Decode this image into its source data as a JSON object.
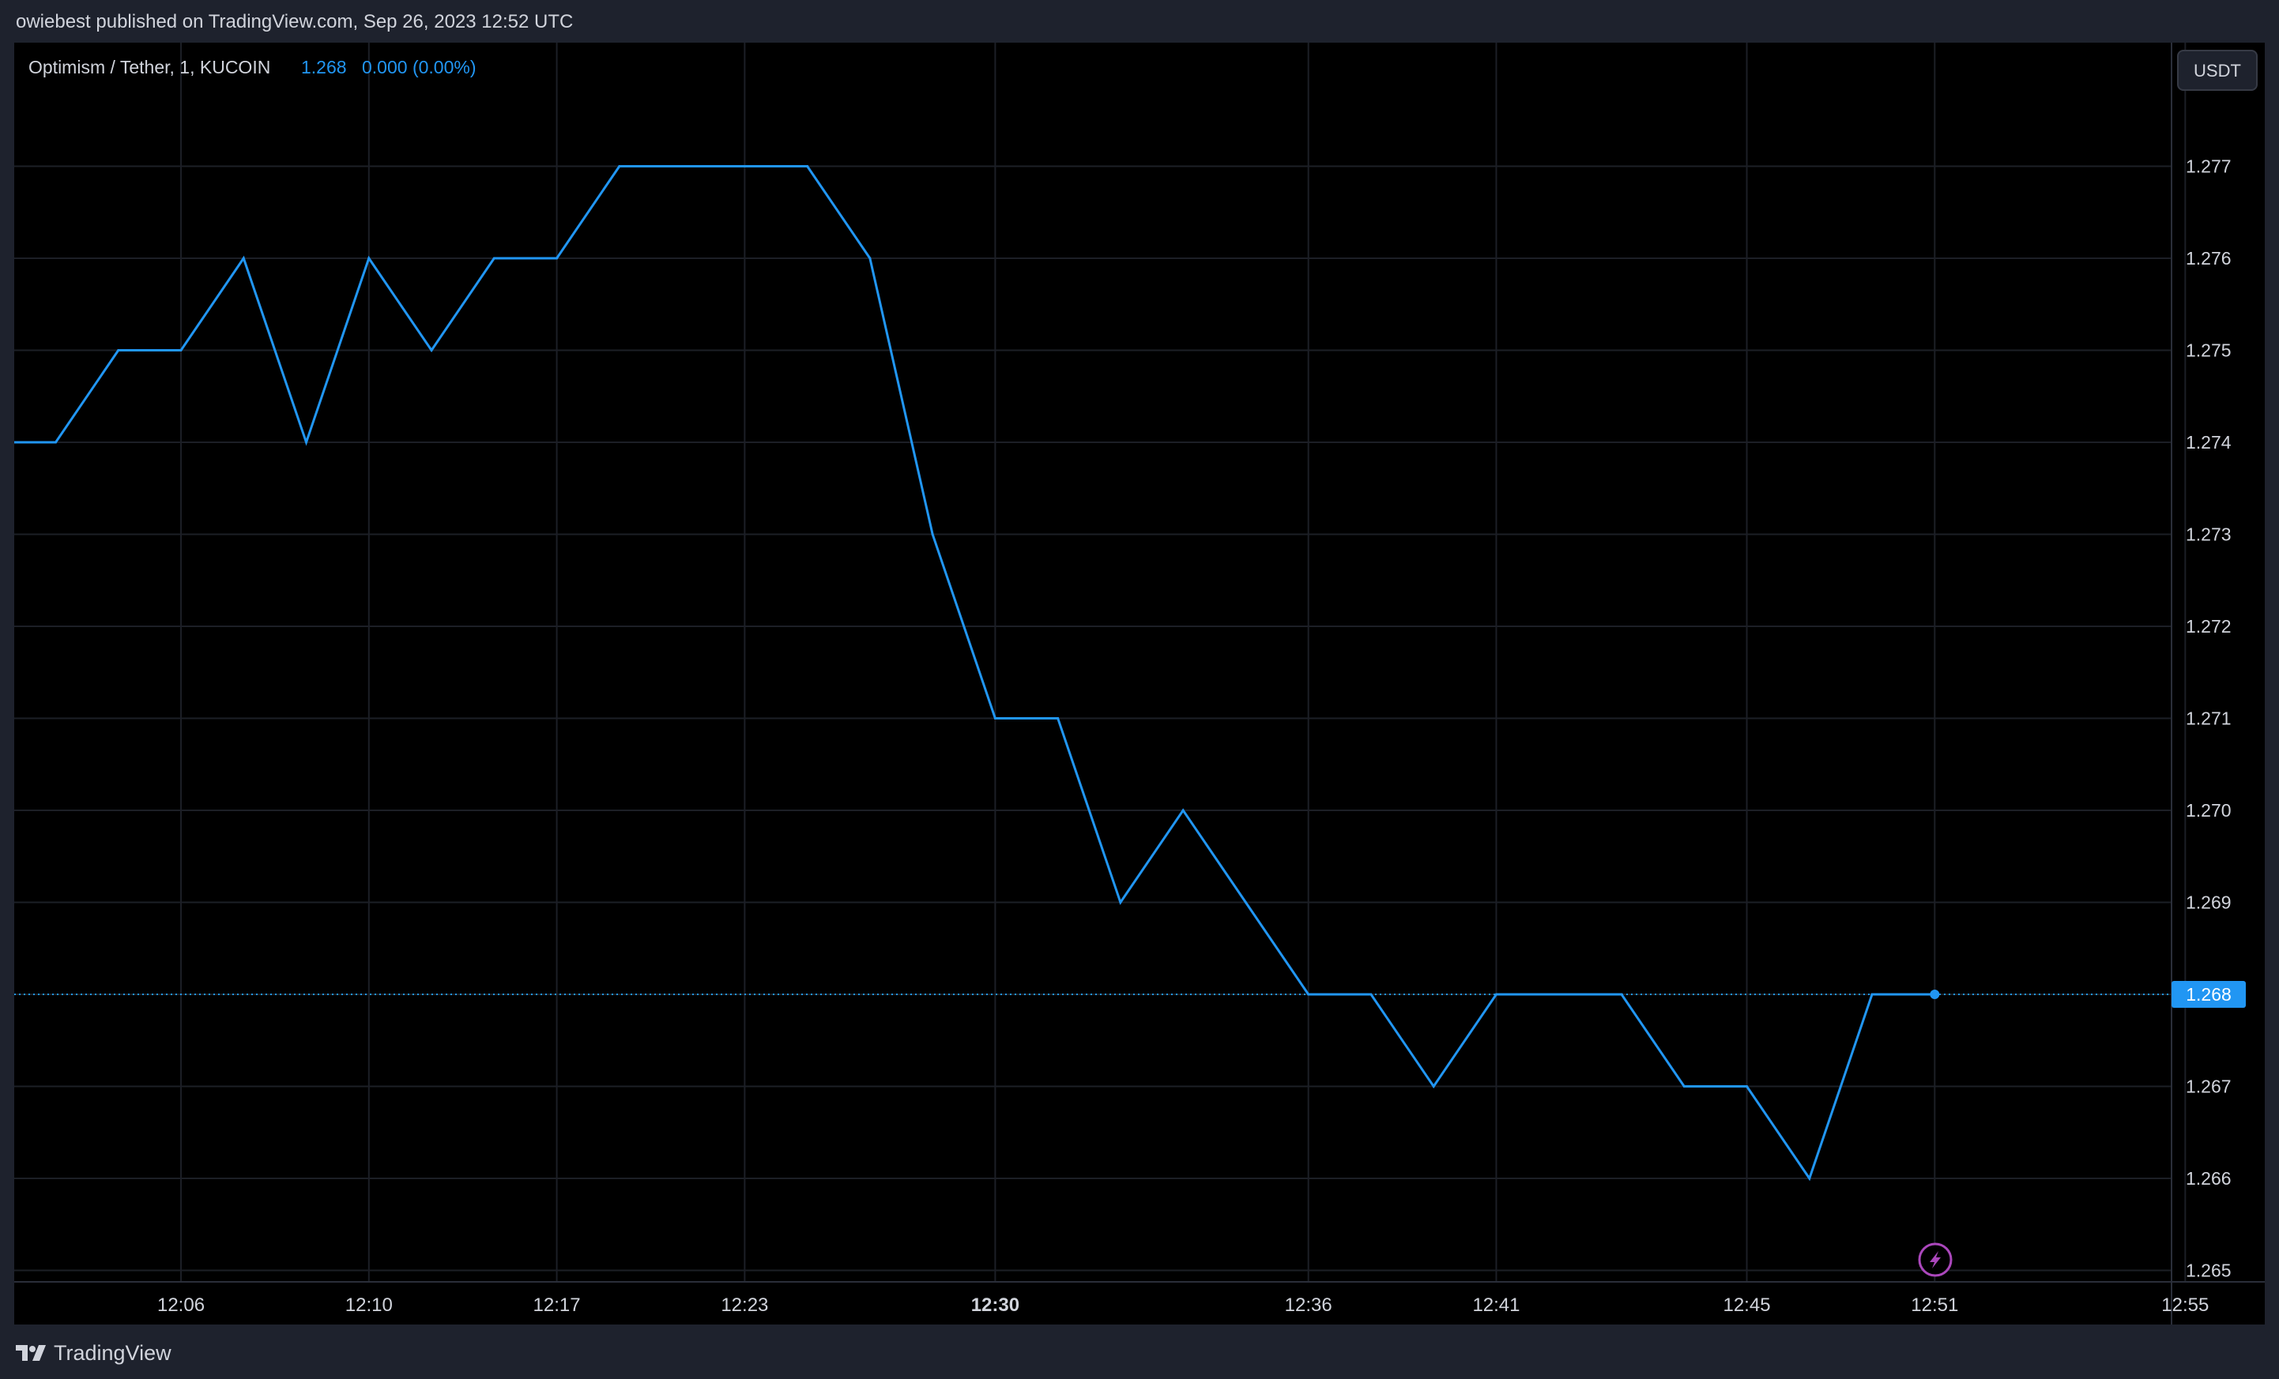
{
  "header": {
    "published_text": "owiebest published on TradingView.com, Sep 26, 2023 12:52 UTC"
  },
  "legend": {
    "symbol": "Optimism / Tether, 1, KUCOIN",
    "last": "1.268",
    "change": "0.000 (0.00%)"
  },
  "currency_button": "USDT",
  "last_price_label": "1.268",
  "footer": {
    "brand": "TradingView"
  },
  "colors": {
    "line": "#2196f3",
    "grid": "#1c1f26",
    "axis_text": "#d1d4dc",
    "background": "#000000",
    "price_label_bg": "#2196f3",
    "lightning": "#ab47bc"
  },
  "icons": {
    "brand_logo": "tradingview-logo-icon",
    "lightning": "lightning-bolt-icon"
  },
  "chart_data": {
    "type": "line",
    "title": "Optimism / Tether, 1, KUCOIN",
    "xlabel": "",
    "ylabel": "",
    "ylim": [
      1.265,
      1.277
    ],
    "grid": true,
    "y_ticks": [
      "1.277",
      "1.276",
      "1.275",
      "1.274",
      "1.273",
      "1.272",
      "1.271",
      "1.270",
      "1.269",
      "1.268",
      "1.267",
      "1.266",
      "1.265"
    ],
    "x_ticks": [
      {
        "label": "12:06",
        "minute": 6,
        "bold": false
      },
      {
        "label": "12:10",
        "minute": 9,
        "bold": false
      },
      {
        "label": "12:17",
        "minute": 12,
        "bold": false
      },
      {
        "label": "12:23",
        "minute": 15,
        "bold": false
      },
      {
        "label": "12:30",
        "minute": 19,
        "bold": true
      },
      {
        "label": "12:36",
        "minute": 24,
        "bold": false
      },
      {
        "label": "12:41",
        "minute": 27,
        "bold": false
      },
      {
        "label": "12:45",
        "minute": 31,
        "bold": false
      },
      {
        "label": "12:51",
        "minute": 34,
        "bold": false
      },
      {
        "label": "12:55",
        "minute": 38,
        "bold": false
      }
    ],
    "series": [
      {
        "values": [
          [
            4,
            1.274
          ],
          [
            5,
            1.275
          ],
          [
            6,
            1.275
          ],
          [
            7,
            1.276
          ],
          [
            8,
            1.274
          ],
          [
            9,
            1.276
          ],
          [
            10,
            1.275
          ],
          [
            11,
            1.276
          ],
          [
            12,
            1.276
          ],
          [
            13,
            1.277
          ],
          [
            14,
            1.277
          ],
          [
            15,
            1.277
          ],
          [
            16,
            1.277
          ],
          [
            17,
            1.276
          ],
          [
            18,
            1.273
          ],
          [
            19,
            1.271
          ],
          [
            20,
            1.271
          ],
          [
            21,
            1.269
          ],
          [
            22,
            1.27
          ],
          [
            23,
            1.269
          ],
          [
            24,
            1.268
          ],
          [
            25,
            1.268
          ],
          [
            26,
            1.267
          ],
          [
            27,
            1.268
          ],
          [
            28,
            1.268
          ],
          [
            29,
            1.268
          ],
          [
            30,
            1.267
          ],
          [
            31,
            1.267
          ],
          [
            32,
            1.266
          ],
          [
            33,
            1.268
          ],
          [
            34,
            1.268
          ]
        ]
      }
    ],
    "last_value": 1.268
  }
}
